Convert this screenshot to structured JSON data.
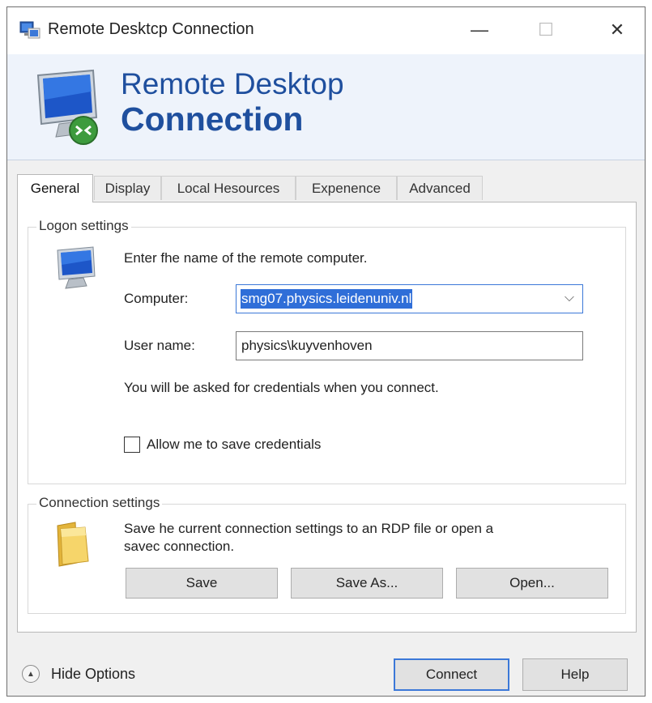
{
  "window": {
    "title": "Remote Desktcp Connection",
    "controls": {
      "minimize": "—",
      "maximize": "☐",
      "close": "✕"
    }
  },
  "banner": {
    "title_line1": "Remote Desktop",
    "title_line2": "Connection",
    "icon": "remote-desktop-monitor-icon"
  },
  "tabs": [
    {
      "label": "General",
      "active": true
    },
    {
      "label": "Display",
      "active": false
    },
    {
      "label": "Local Hesources",
      "active": false
    },
    {
      "label": "Expenence",
      "active": false
    },
    {
      "label": "Advanced",
      "active": false
    }
  ],
  "logon": {
    "group_title": "Logon settings",
    "instruction": "Enter fhe name of the remote computer.",
    "computer_label": "Computer:",
    "computer_value": "smg07.physics.leidenuniv.nl",
    "username_label": "User name:",
    "username_value": "physics\\kuyvenhoven",
    "credentials_note": "You will be asked for credentials when you connect.",
    "save_credentials_label": "Allow me to save credentials",
    "save_credentials_checked": false,
    "icon": "computer-icon"
  },
  "connection": {
    "group_title": "Connection settings",
    "description_line1": "Save he current connection settings to an RDP file or open a",
    "description_line2": "savec connection.",
    "save_label": "Save",
    "save_as_label": "Save As...",
    "open_label": "Open...",
    "icon": "folder-icon"
  },
  "footer": {
    "hide_options_label": "Hide Options",
    "connect_label": "Connect",
    "help_label": "Help"
  },
  "colors": {
    "accent": "#3b78d8",
    "banner_text": "#1f4f9e",
    "selection": "#2f6ed8"
  }
}
